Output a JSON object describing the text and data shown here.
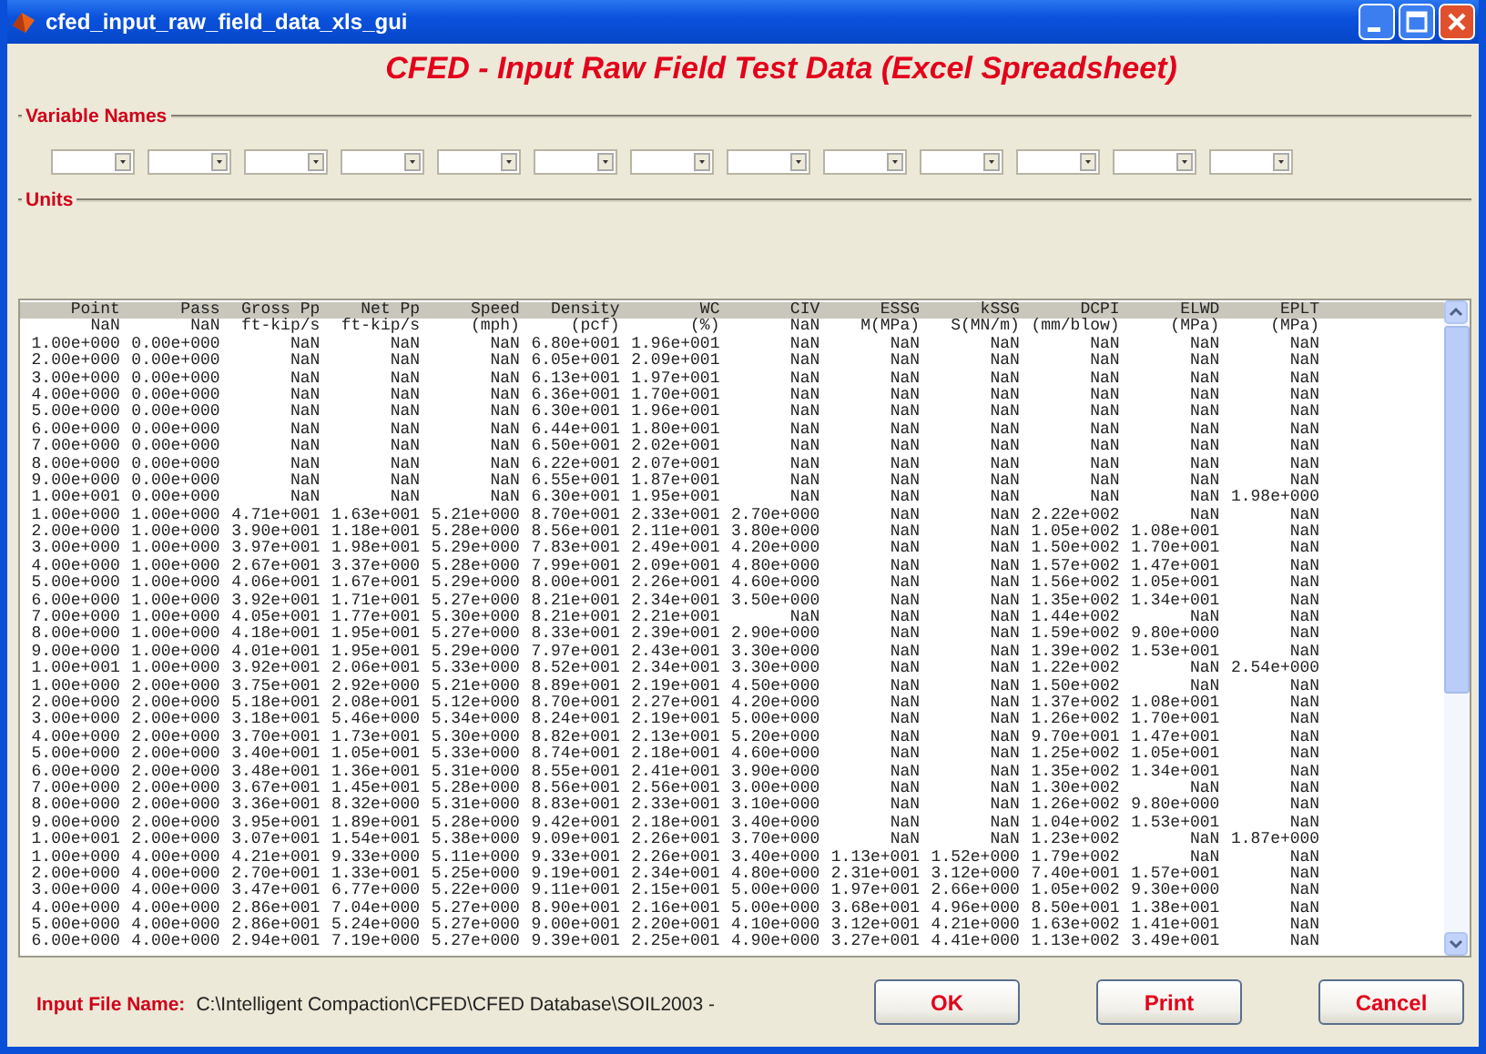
{
  "window": {
    "title": "cfed_input_raw_field_data_xls_gui"
  },
  "heading": "CFED - Input Raw Field Test Data (Excel Spreadsheet)",
  "variable_names": {
    "label": "Variable Names",
    "dropdowns": [
      {
        "kind": "dropdown"
      },
      {
        "kind": "dropdown"
      },
      {
        "kind": "dropdown"
      },
      {
        "kind": "dropdown"
      },
      {
        "kind": "dropdown"
      },
      {
        "kind": "dropdown"
      },
      {
        "kind": "dropdown"
      },
      {
        "kind": "dropdown"
      },
      {
        "kind": "dropdown"
      },
      {
        "kind": "dropdown"
      },
      {
        "kind": "dropdown"
      },
      {
        "kind": "dropdown"
      },
      {
        "kind": "dropdown"
      }
    ]
  },
  "units": {
    "label": "Units"
  },
  "listbox": {
    "lines": [
      {
        "selected": true,
        "cells": [
          "Point",
          "Pass",
          "Gross Pp",
          "Net Pp",
          "Speed",
          "Density",
          "WC",
          "CIV",
          "ESSG",
          "kSSG",
          "DCPI",
          "ELWD",
          "EPLT"
        ]
      },
      {
        "selected": false,
        "cells": [
          "NaN",
          "NaN",
          "ft-kip/s",
          "ft-kip/s",
          "(mph)",
          "(pcf)",
          "(%)",
          "NaN",
          "M(MPa)",
          "S(MN/m)",
          "(mm/blow)",
          "(MPa)",
          "(MPa)"
        ]
      },
      {
        "selected": false,
        "cells": [
          "1.00e+000",
          "0.00e+000",
          "NaN",
          "NaN",
          "NaN",
          "6.80e+001",
          "1.96e+001",
          "NaN",
          "NaN",
          "NaN",
          "NaN",
          "NaN",
          "NaN"
        ]
      },
      {
        "selected": false,
        "cells": [
          "2.00e+000",
          "0.00e+000",
          "NaN",
          "NaN",
          "NaN",
          "6.05e+001",
          "2.09e+001",
          "NaN",
          "NaN",
          "NaN",
          "NaN",
          "NaN",
          "NaN"
        ]
      },
      {
        "selected": false,
        "cells": [
          "3.00e+000",
          "0.00e+000",
          "NaN",
          "NaN",
          "NaN",
          "6.13e+001",
          "1.97e+001",
          "NaN",
          "NaN",
          "NaN",
          "NaN",
          "NaN",
          "NaN"
        ]
      },
      {
        "selected": false,
        "cells": [
          "4.00e+000",
          "0.00e+000",
          "NaN",
          "NaN",
          "NaN",
          "6.36e+001",
          "1.70e+001",
          "NaN",
          "NaN",
          "NaN",
          "NaN",
          "NaN",
          "NaN"
        ]
      },
      {
        "selected": false,
        "cells": [
          "5.00e+000",
          "0.00e+000",
          "NaN",
          "NaN",
          "NaN",
          "6.30e+001",
          "1.96e+001",
          "NaN",
          "NaN",
          "NaN",
          "NaN",
          "NaN",
          "NaN"
        ]
      },
      {
        "selected": false,
        "cells": [
          "6.00e+000",
          "0.00e+000",
          "NaN",
          "NaN",
          "NaN",
          "6.44e+001",
          "1.80e+001",
          "NaN",
          "NaN",
          "NaN",
          "NaN",
          "NaN",
          "NaN"
        ]
      },
      {
        "selected": false,
        "cells": [
          "7.00e+000",
          "0.00e+000",
          "NaN",
          "NaN",
          "NaN",
          "6.50e+001",
          "2.02e+001",
          "NaN",
          "NaN",
          "NaN",
          "NaN",
          "NaN",
          "NaN"
        ]
      },
      {
        "selected": false,
        "cells": [
          "8.00e+000",
          "0.00e+000",
          "NaN",
          "NaN",
          "NaN",
          "6.22e+001",
          "2.07e+001",
          "NaN",
          "NaN",
          "NaN",
          "NaN",
          "NaN",
          "NaN"
        ]
      },
      {
        "selected": false,
        "cells": [
          "9.00e+000",
          "0.00e+000",
          "NaN",
          "NaN",
          "NaN",
          "6.55e+001",
          "1.87e+001",
          "NaN",
          "NaN",
          "NaN",
          "NaN",
          "NaN",
          "NaN"
        ]
      },
      {
        "selected": false,
        "cells": [
          "1.00e+001",
          "0.00e+000",
          "NaN",
          "NaN",
          "NaN",
          "6.30e+001",
          "1.95e+001",
          "NaN",
          "NaN",
          "NaN",
          "NaN",
          "NaN",
          "1.98e+000"
        ]
      },
      {
        "selected": false,
        "cells": [
          "1.00e+000",
          "1.00e+000",
          "4.71e+001",
          "1.63e+001",
          "5.21e+000",
          "8.70e+001",
          "2.33e+001",
          "2.70e+000",
          "NaN",
          "NaN",
          "2.22e+002",
          "NaN",
          "NaN"
        ]
      },
      {
        "selected": false,
        "cells": [
          "2.00e+000",
          "1.00e+000",
          "3.90e+001",
          "1.18e+001",
          "5.28e+000",
          "8.56e+001",
          "2.11e+001",
          "3.80e+000",
          "NaN",
          "NaN",
          "1.05e+002",
          "1.08e+001",
          "NaN"
        ]
      },
      {
        "selected": false,
        "cells": [
          "3.00e+000",
          "1.00e+000",
          "3.97e+001",
          "1.98e+001",
          "5.29e+000",
          "7.83e+001",
          "2.49e+001",
          "4.20e+000",
          "NaN",
          "NaN",
          "1.50e+002",
          "1.70e+001",
          "NaN"
        ]
      },
      {
        "selected": false,
        "cells": [
          "4.00e+000",
          "1.00e+000",
          "2.67e+001",
          "3.37e+000",
          "5.28e+000",
          "7.99e+001",
          "2.09e+001",
          "4.80e+000",
          "NaN",
          "NaN",
          "1.57e+002",
          "1.47e+001",
          "NaN"
        ]
      },
      {
        "selected": false,
        "cells": [
          "5.00e+000",
          "1.00e+000",
          "4.06e+001",
          "1.67e+001",
          "5.29e+000",
          "8.00e+001",
          "2.26e+001",
          "4.60e+000",
          "NaN",
          "NaN",
          "1.56e+002",
          "1.05e+001",
          "NaN"
        ]
      },
      {
        "selected": false,
        "cells": [
          "6.00e+000",
          "1.00e+000",
          "3.92e+001",
          "1.71e+001",
          "5.27e+000",
          "8.21e+001",
          "2.34e+001",
          "3.50e+000",
          "NaN",
          "NaN",
          "1.35e+002",
          "1.34e+001",
          "NaN"
        ]
      },
      {
        "selected": false,
        "cells": [
          "7.00e+000",
          "1.00e+000",
          "4.05e+001",
          "1.77e+001",
          "5.30e+000",
          "8.21e+001",
          "2.21e+001",
          "NaN",
          "NaN",
          "NaN",
          "1.44e+002",
          "NaN",
          "NaN"
        ]
      },
      {
        "selected": false,
        "cells": [
          "8.00e+000",
          "1.00e+000",
          "4.18e+001",
          "1.95e+001",
          "5.27e+000",
          "8.33e+001",
          "2.39e+001",
          "2.90e+000",
          "NaN",
          "NaN",
          "1.59e+002",
          "9.80e+000",
          "NaN"
        ]
      },
      {
        "selected": false,
        "cells": [
          "9.00e+000",
          "1.00e+000",
          "4.01e+001",
          "1.95e+001",
          "5.29e+000",
          "7.97e+001",
          "2.43e+001",
          "3.30e+000",
          "NaN",
          "NaN",
          "1.39e+002",
          "1.53e+001",
          "NaN"
        ]
      },
      {
        "selected": false,
        "cells": [
          "1.00e+001",
          "1.00e+000",
          "3.92e+001",
          "2.06e+001",
          "5.33e+000",
          "8.52e+001",
          "2.34e+001",
          "3.30e+000",
          "NaN",
          "NaN",
          "1.22e+002",
          "NaN",
          "2.54e+000"
        ]
      },
      {
        "selected": false,
        "cells": [
          "1.00e+000",
          "2.00e+000",
          "3.75e+001",
          "2.92e+000",
          "5.21e+000",
          "8.89e+001",
          "2.19e+001",
          "4.50e+000",
          "NaN",
          "NaN",
          "1.50e+002",
          "NaN",
          "NaN"
        ]
      },
      {
        "selected": false,
        "cells": [
          "2.00e+000",
          "2.00e+000",
          "5.18e+001",
          "2.08e+001",
          "5.12e+000",
          "8.70e+001",
          "2.27e+001",
          "4.20e+000",
          "NaN",
          "NaN",
          "1.37e+002",
          "1.08e+001",
          "NaN"
        ]
      },
      {
        "selected": false,
        "cells": [
          "3.00e+000",
          "2.00e+000",
          "3.18e+001",
          "5.46e+000",
          "5.34e+000",
          "8.24e+001",
          "2.19e+001",
          "5.00e+000",
          "NaN",
          "NaN",
          "1.26e+002",
          "1.70e+001",
          "NaN"
        ]
      },
      {
        "selected": false,
        "cells": [
          "4.00e+000",
          "2.00e+000",
          "3.70e+001",
          "1.73e+001",
          "5.30e+000",
          "8.82e+001",
          "2.13e+001",
          "5.20e+000",
          "NaN",
          "NaN",
          "9.70e+001",
          "1.47e+001",
          "NaN"
        ]
      },
      {
        "selected": false,
        "cells": [
          "5.00e+000",
          "2.00e+000",
          "3.40e+001",
          "1.05e+001",
          "5.33e+000",
          "8.74e+001",
          "2.18e+001",
          "4.60e+000",
          "NaN",
          "NaN",
          "1.25e+002",
          "1.05e+001",
          "NaN"
        ]
      },
      {
        "selected": false,
        "cells": [
          "6.00e+000",
          "2.00e+000",
          "3.48e+001",
          "1.36e+001",
          "5.31e+000",
          "8.55e+001",
          "2.41e+001",
          "3.90e+000",
          "NaN",
          "NaN",
          "1.35e+002",
          "1.34e+001",
          "NaN"
        ]
      },
      {
        "selected": false,
        "cells": [
          "7.00e+000",
          "2.00e+000",
          "3.67e+001",
          "1.45e+001",
          "5.28e+000",
          "8.56e+001",
          "2.56e+001",
          "3.00e+000",
          "NaN",
          "NaN",
          "1.30e+002",
          "NaN",
          "NaN"
        ]
      },
      {
        "selected": false,
        "cells": [
          "8.00e+000",
          "2.00e+000",
          "3.36e+001",
          "8.32e+000",
          "5.31e+000",
          "8.83e+001",
          "2.33e+001",
          "3.10e+000",
          "NaN",
          "NaN",
          "1.26e+002",
          "9.80e+000",
          "NaN"
        ]
      },
      {
        "selected": false,
        "cells": [
          "9.00e+000",
          "2.00e+000",
          "3.95e+001",
          "1.89e+001",
          "5.28e+000",
          "9.42e+001",
          "2.18e+001",
          "3.40e+000",
          "NaN",
          "NaN",
          "1.04e+002",
          "1.53e+001",
          "NaN"
        ]
      },
      {
        "selected": false,
        "cells": [
          "1.00e+001",
          "2.00e+000",
          "3.07e+001",
          "1.54e+001",
          "5.38e+000",
          "9.09e+001",
          "2.26e+001",
          "3.70e+000",
          "NaN",
          "NaN",
          "1.23e+002",
          "NaN",
          "1.87e+000"
        ]
      },
      {
        "selected": false,
        "cells": [
          "1.00e+000",
          "4.00e+000",
          "4.21e+001",
          "9.33e+000",
          "5.11e+000",
          "9.33e+001",
          "2.26e+001",
          "3.40e+000",
          "1.13e+001",
          "1.52e+000",
          "1.79e+002",
          "NaN",
          "NaN"
        ]
      },
      {
        "selected": false,
        "cells": [
          "2.00e+000",
          "4.00e+000",
          "2.70e+001",
          "1.33e+001",
          "5.25e+000",
          "9.19e+001",
          "2.34e+001",
          "4.80e+000",
          "2.31e+001",
          "3.12e+000",
          "7.40e+001",
          "1.57e+001",
          "NaN"
        ]
      },
      {
        "selected": false,
        "cells": [
          "3.00e+000",
          "4.00e+000",
          "3.47e+001",
          "6.77e+000",
          "5.22e+000",
          "9.11e+001",
          "2.15e+001",
          "5.00e+000",
          "1.97e+001",
          "2.66e+000",
          "1.05e+002",
          "9.30e+000",
          "NaN"
        ]
      },
      {
        "selected": false,
        "cells": [
          "4.00e+000",
          "4.00e+000",
          "2.86e+001",
          "7.04e+000",
          "5.27e+000",
          "8.90e+001",
          "2.16e+001",
          "5.00e+000",
          "3.68e+001",
          "4.96e+000",
          "8.50e+001",
          "1.38e+001",
          "NaN"
        ]
      },
      {
        "selected": false,
        "cells": [
          "5.00e+000",
          "4.00e+000",
          "2.86e+001",
          "5.24e+000",
          "5.27e+000",
          "9.00e+001",
          "2.20e+001",
          "4.10e+000",
          "3.12e+001",
          "4.21e+000",
          "1.63e+002",
          "1.41e+001",
          "NaN"
        ]
      },
      {
        "selected": false,
        "cells": [
          "6.00e+000",
          "4.00e+000",
          "2.94e+001",
          "7.19e+000",
          "5.27e+000",
          "9.39e+001",
          "2.25e+001",
          "4.90e+000",
          "3.27e+001",
          "4.41e+000",
          "1.13e+002",
          "3.49e+001",
          "NaN"
        ]
      }
    ]
  },
  "input_file": {
    "label": "Input File Name:",
    "value": "C:\\Intelligent Compaction\\CFED\\CFED Database\\SOIL2003 -"
  },
  "buttons": [
    "OK",
    "Print",
    "Cancel"
  ]
}
